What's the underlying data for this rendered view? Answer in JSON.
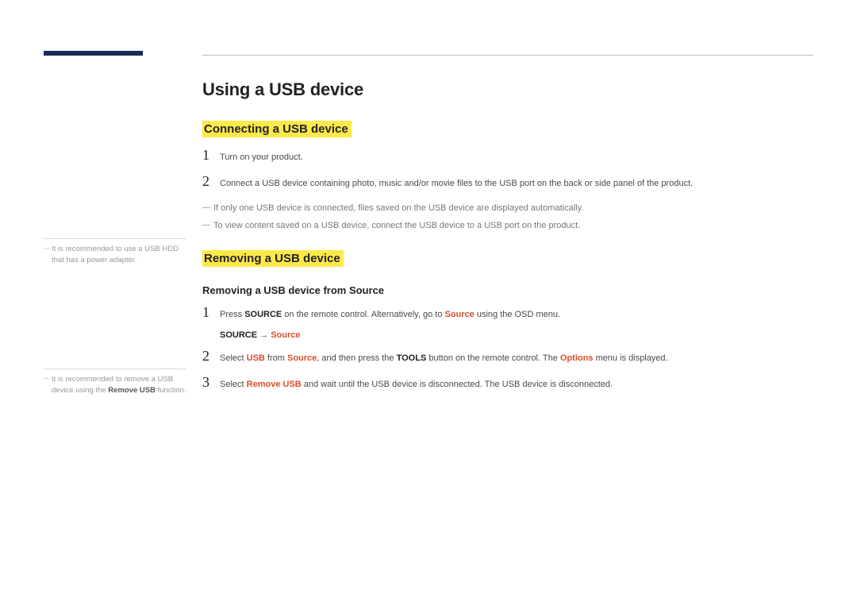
{
  "title": "Using a USB device",
  "section1": {
    "heading": "Connecting a USB device",
    "steps": [
      "Turn on your product.",
      "Connect a USB device containing photo, music and/or movie files to the USB port on the back or side panel of the product."
    ],
    "notes": [
      "If only one USB device is connected, files saved on the USB device are displayed automatically.",
      "To view content saved on a USB device, connect the USB device to a USB port on the product."
    ]
  },
  "side_note_1": "It is recommended to use a USB HDD that has a power adapter.",
  "section2": {
    "heading": "Removing a USB device",
    "subheading": "Removing a USB device from Source",
    "step1_pre": "Press ",
    "step1_source": "SOURCE",
    "step1_mid": " on the remote control. Alternatively, go to ",
    "step1_src2": "Source",
    "step1_post": " using the OSD menu.",
    "path_left": "SOURCE",
    "path_arrow": " → ",
    "path_right": "Source",
    "step2_pre": "Select ",
    "step2_usb": "USB",
    "step2_mid1": " from ",
    "step2_src": "Source",
    "step2_mid2": ", and then press the ",
    "step2_tools": "TOOLS",
    "step2_mid3": " button on the remote control. The ",
    "step2_options": "Options",
    "step2_post": " menu is displayed.",
    "step3_pre": "Select ",
    "step3_remove": "Remove USB",
    "step3_post": " and wait until the USB device is disconnected. The USB device is disconnected."
  },
  "side_note_2_pre": "It is recommended to remove a USB device using the ",
  "side_note_2_bold": "Remove USB",
  "side_note_2_post": " function.",
  "nums": {
    "n1": "1",
    "n2": "2",
    "n3": "3"
  }
}
